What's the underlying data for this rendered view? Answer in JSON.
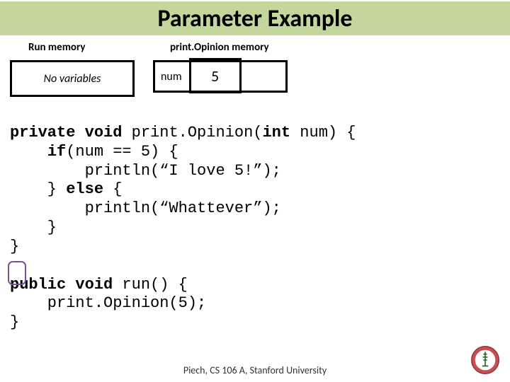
{
  "title": "Parameter Example",
  "memory": {
    "run_label": "Run memory",
    "po_label": "print.Opinion memory",
    "no_variables": "No variables",
    "var_name": "num",
    "var_value": "5"
  },
  "code": {
    "line1_a": "private void",
    "line1_b": " print.Opinion(",
    "line1_c": "int",
    "line1_d": " num) {",
    "line2_a": "    ",
    "line2_b": "if",
    "line2_c": "(num == 5) {",
    "line3": "        println(“I love 5!”);",
    "line4_a": "    } ",
    "line4_b": "else",
    "line4_c": " {",
    "line5": "        println(“Whattever”);",
    "line6": "    }",
    "line7": "}",
    "blank": "",
    "line8_a": "public void",
    "line8_b": " run() {",
    "line9": "    print.Opinion(5);",
    "line10": "}"
  },
  "footer": "Piech, CS 106 A, Stanford University"
}
